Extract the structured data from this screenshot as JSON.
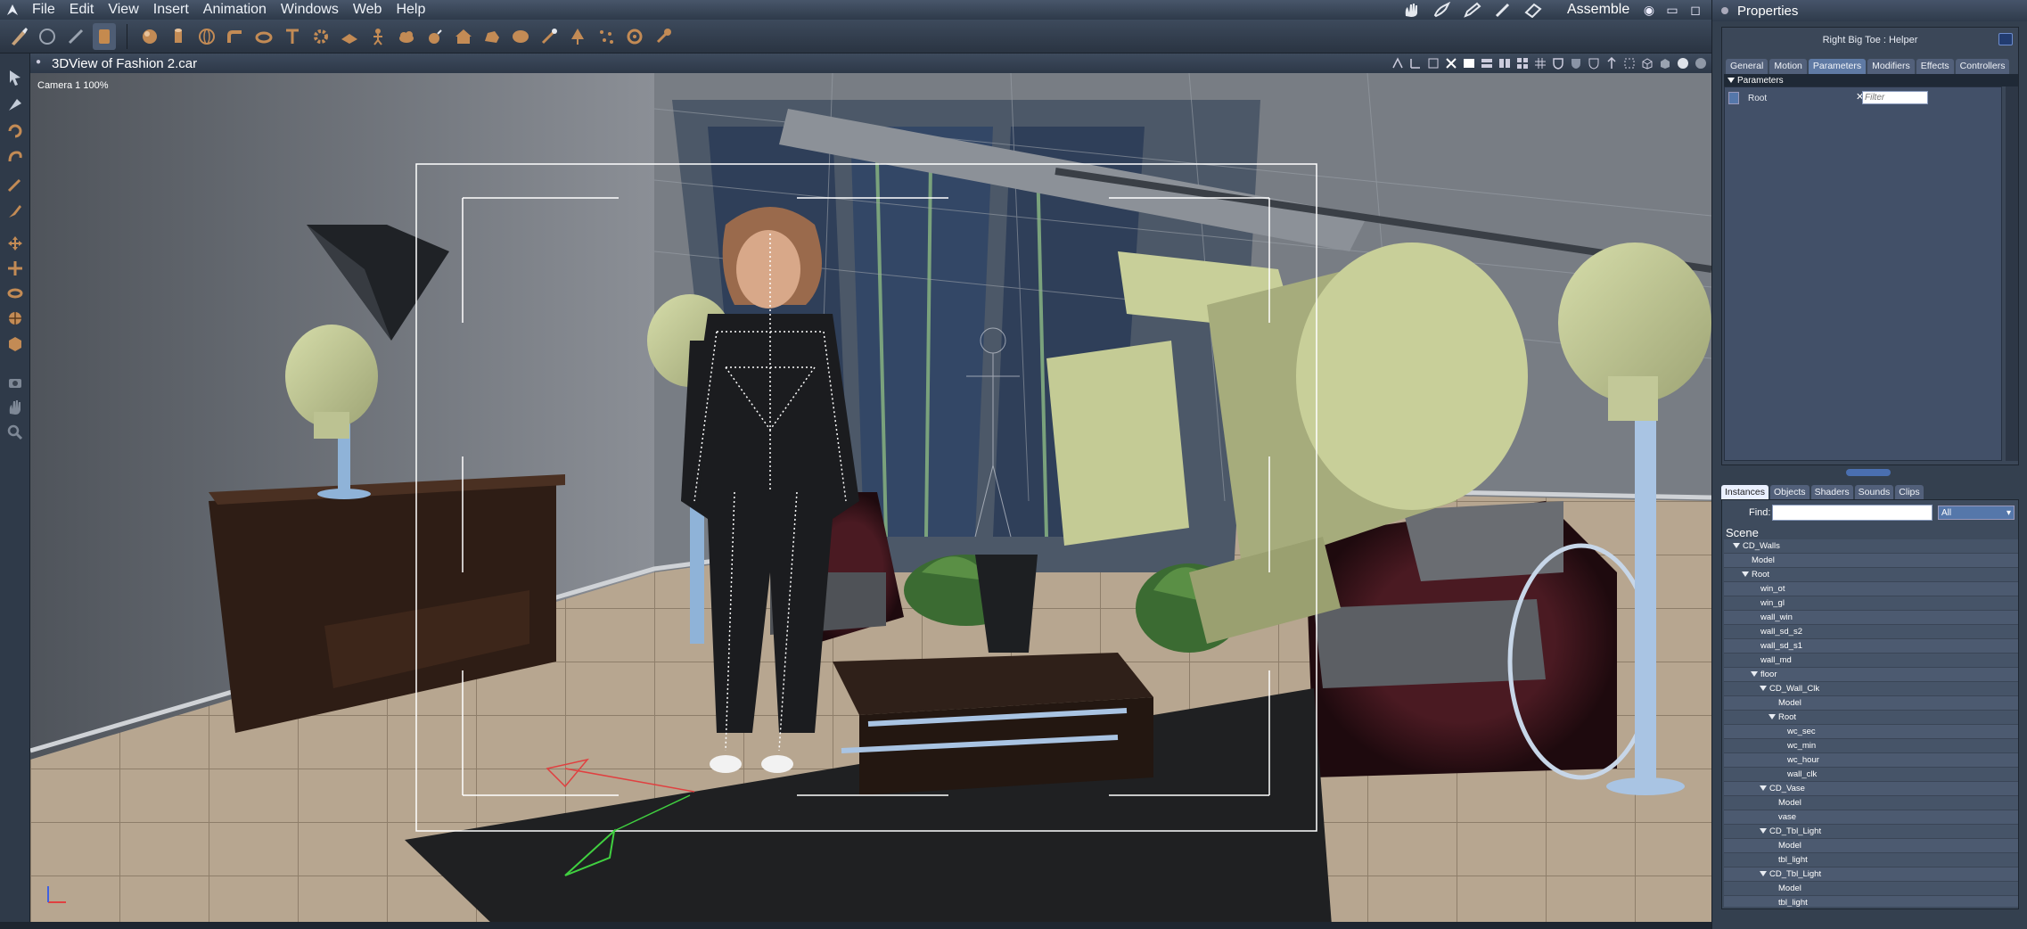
{
  "menubar": {
    "items": [
      "File",
      "Edit",
      "View",
      "Insert",
      "Animation",
      "Windows",
      "Web",
      "Help"
    ],
    "room": "Assemble"
  },
  "viewport": {
    "title": "3DView of Fashion 2.car",
    "camera": "Camera 1 100%"
  },
  "properties": {
    "title": "Properties",
    "object": "Right Big Toe : Helper",
    "tabs": [
      "General",
      "Motion",
      "Parameters",
      "Modifiers",
      "Effects",
      "Controllers"
    ],
    "active_tab": "Parameters",
    "section": "Parameters",
    "param_root": "Root",
    "filter_placeholder": "Filter"
  },
  "instances": {
    "tabs": [
      "Instances",
      "Objects",
      "Shaders",
      "Sounds",
      "Clips"
    ],
    "active_tab": "Instances",
    "find_label": "Find:",
    "filter_value": "All",
    "tree_root": "Scene",
    "tree": [
      {
        "label": "CD_Walls",
        "depth": 0,
        "open": true
      },
      {
        "label": "Model",
        "depth": 1
      },
      {
        "label": "Root",
        "depth": 1,
        "open": true
      },
      {
        "label": "win_ot",
        "depth": 2
      },
      {
        "label": "win_gl",
        "depth": 2
      },
      {
        "label": "wall_win",
        "depth": 2
      },
      {
        "label": "wall_sd_s2",
        "depth": 2
      },
      {
        "label": "wall_sd_s1",
        "depth": 2
      },
      {
        "label": "wall_md",
        "depth": 2
      },
      {
        "label": "floor",
        "depth": 2,
        "open": true
      },
      {
        "label": "CD_Wall_Clk",
        "depth": 3,
        "open": true
      },
      {
        "label": "Model",
        "depth": 4
      },
      {
        "label": "Root",
        "depth": 4,
        "open": true
      },
      {
        "label": "wc_sec",
        "depth": 5
      },
      {
        "label": "wc_min",
        "depth": 5
      },
      {
        "label": "wc_hour",
        "depth": 5
      },
      {
        "label": "wall_clk",
        "depth": 5
      },
      {
        "label": "CD_Vase",
        "depth": 3,
        "open": true
      },
      {
        "label": "Model",
        "depth": 4
      },
      {
        "label": "vase",
        "depth": 4
      },
      {
        "label": "CD_Tbl_Light",
        "depth": 3,
        "open": true
      },
      {
        "label": "Model",
        "depth": 4
      },
      {
        "label": "tbl_light",
        "depth": 4
      },
      {
        "label": "CD_Tbl_Light",
        "depth": 3,
        "open": true
      },
      {
        "label": "Model",
        "depth": 4
      },
      {
        "label": "tbl_light",
        "depth": 4
      }
    ]
  },
  "icons": {
    "menubar": [
      "app-logo-icon",
      "hand-icon",
      "brush-icon",
      "pencil-icon",
      "pen-icon",
      "eraser-icon",
      "eye-icon",
      "minimize-icon",
      "close-icon"
    ],
    "toolbar": [
      "paint-brush-icon",
      "grab-hand-icon",
      "smooth-icon",
      "sculpt-icon",
      "sphere-icon",
      "cylinder-icon",
      "globe-icon",
      "bend-icon",
      "torus-icon",
      "text-icon",
      "gear-icon",
      "plane-icon",
      "figure-icon",
      "cloud-icon",
      "bomb-icon",
      "house-icon",
      "rock-icon",
      "lens-icon",
      "tree-icon",
      "cog-icon",
      "light-icon"
    ]
  },
  "colors": {
    "ui_bg": "#2a3442",
    "panel": "#34404f",
    "accent": "#5f7aa4",
    "floor": "#b9a792",
    "wall": "#8a8d92",
    "lamp": "#c8cf99"
  }
}
